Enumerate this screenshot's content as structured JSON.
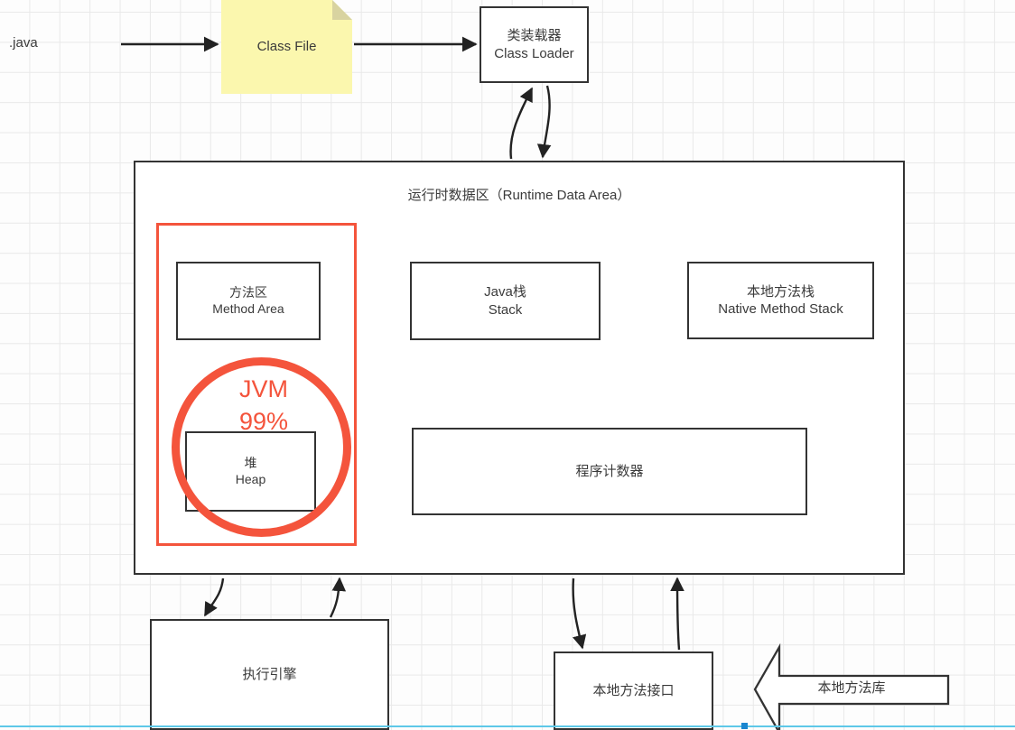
{
  "diagram": {
    "title": "JVM Runtime Data Area Architecture",
    "colors": {
      "stroke": "#333333",
      "text": "#3a3a3a",
      "annotation_red": "#f4543c",
      "class_file_fill": "#fbf7ae",
      "grid": "#e9e9e9",
      "guide_blue": "#5ec8e8"
    }
  },
  "source_label": ".java",
  "class_file": {
    "label": "Class File"
  },
  "class_loader": {
    "cn": "类装载器",
    "en": "Class Loader"
  },
  "runtime_area": {
    "title": "运行时数据区（Runtime Data Area）"
  },
  "method_area": {
    "cn": "方法区",
    "en": "Method Area"
  },
  "heap": {
    "cn": "堆",
    "en": "Heap"
  },
  "java_stack": {
    "cn": "Java栈",
    "en": "Stack"
  },
  "native_method_stack": {
    "cn": "本地方法栈",
    "en": "Native Method Stack"
  },
  "program_counter": {
    "cn": "程序计数器"
  },
  "execution_engine": {
    "cn": "执行引擎"
  },
  "native_method_interface": {
    "cn": "本地方法接口"
  },
  "native_method_library": {
    "cn": "本地方法库"
  },
  "annotation": {
    "line1": "JVM",
    "line2": "99%",
    "color": "#f4543c"
  }
}
